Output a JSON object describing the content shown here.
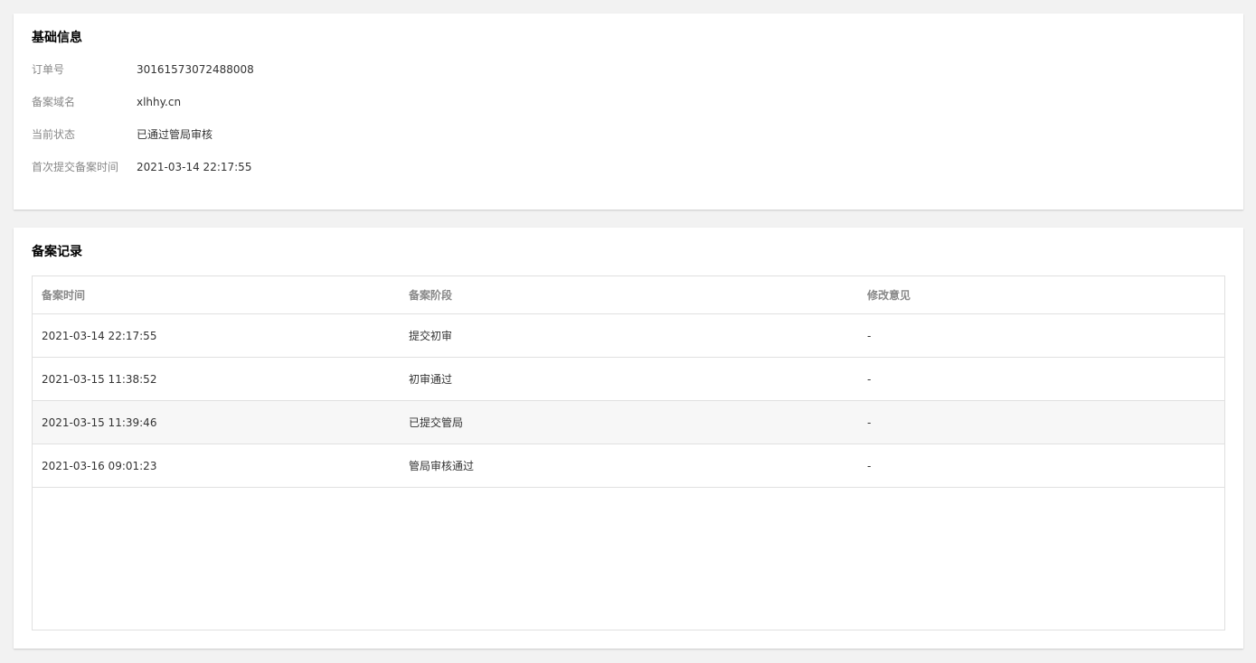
{
  "basic_info": {
    "title": "基础信息",
    "fields": [
      {
        "label": "订单号",
        "value": "30161573072488008"
      },
      {
        "label": "备案域名",
        "value": "xlhhy.cn"
      },
      {
        "label": "当前状态",
        "value": "已通过管局审核"
      },
      {
        "label": "首次提交备案时间",
        "value": "2021-03-14 22:17:55"
      }
    ]
  },
  "records": {
    "title": "备案记录",
    "columns": [
      "备案时间",
      "备案阶段",
      "修改意见"
    ],
    "rows": [
      [
        "2021-03-14 22:17:55",
        "提交初审",
        "-"
      ],
      [
        "2021-03-15 11:38:52",
        "初审通过",
        "-"
      ],
      [
        "2021-03-15 11:39:46",
        "已提交管局",
        "-"
      ],
      [
        "2021-03-16 09:01:23",
        "管局审核通过",
        "-"
      ]
    ]
  },
  "colors": {
    "background": "#f2f2f2",
    "card": "#ffffff",
    "label": "#888888",
    "text": "#333333",
    "row_hover": "#f7f7f7"
  }
}
